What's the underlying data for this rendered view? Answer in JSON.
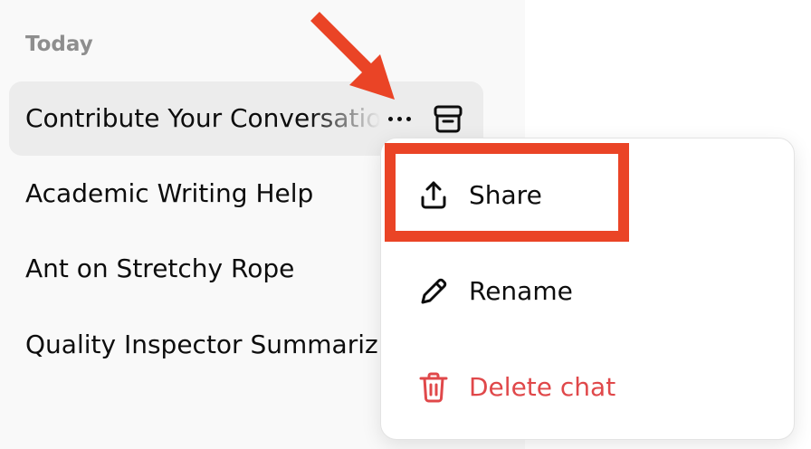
{
  "sidebar": {
    "section_label": "Today",
    "chats": [
      {
        "title": "Contribute Your Conversations"
      },
      {
        "title": "Academic Writing Help"
      },
      {
        "title": "Ant on Stretchy Rope"
      },
      {
        "title": "Quality Inspector Summarizing"
      }
    ],
    "more_icon": "ellipsis-icon",
    "archive_icon": "archive-icon"
  },
  "context_menu": {
    "items": [
      {
        "label": "Share",
        "icon": "share-upload-icon"
      },
      {
        "label": "Rename",
        "icon": "pencil-icon"
      },
      {
        "label": "Delete chat",
        "icon": "trash-icon",
        "color": "#e0484a"
      }
    ]
  },
  "annotation": {
    "color": "#ea4426",
    "arrow_icon": "arrow-pointer-icon"
  }
}
